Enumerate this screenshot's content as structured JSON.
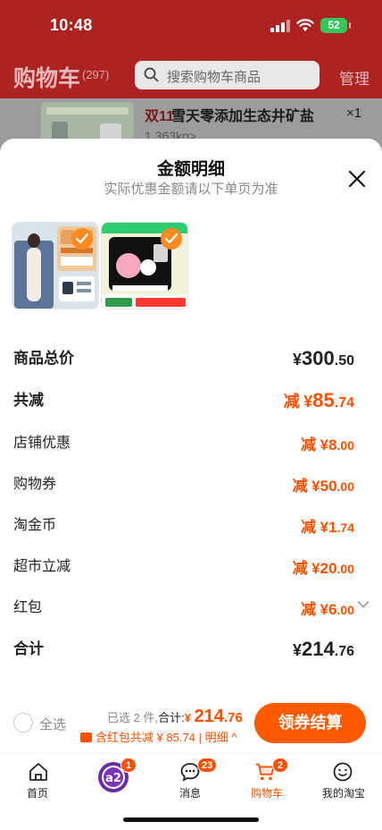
{
  "status": {
    "time": "10:48",
    "battery": "52"
  },
  "header": {
    "title": "购物车",
    "count": "(297)",
    "search_placeholder": "搜索购物车商品",
    "manage_label": "管理"
  },
  "behind_item": {
    "badge": "双11",
    "name": "雪天零添加生态井矿盐",
    "qty": "×1",
    "spec": "1.363kg>"
  },
  "sheet": {
    "title": "金额明细",
    "subtitle": "实际优惠金额请以下单页为准",
    "rows": {
      "total": {
        "label": "商品总价",
        "prefix": "",
        "cur": "¥",
        "int": "300",
        "dec": ".50"
      },
      "reduce": {
        "label": "共减",
        "prefix": "减",
        "cur": "¥",
        "int": "85",
        "dec": ".74"
      },
      "store": {
        "label": "店铺优惠",
        "prefix": "减",
        "cur": "¥",
        "int": "8",
        "dec": ".00"
      },
      "voucher": {
        "label": "购物券",
        "prefix": "减",
        "cur": "¥",
        "int": "50",
        "dec": ".00"
      },
      "coins": {
        "label": "淘金币",
        "prefix": "减",
        "cur": "¥",
        "int": "1",
        "dec": ".74"
      },
      "market": {
        "label": "超市立减",
        "prefix": "减",
        "cur": "¥",
        "int": "20",
        "dec": ".00"
      },
      "redpacket": {
        "label": "红包",
        "prefix": "减",
        "cur": "¥",
        "int": "6",
        "dec": ".00"
      },
      "sum": {
        "label": "合计",
        "prefix": "",
        "cur": "¥",
        "int": "214",
        "dec": ".76"
      }
    }
  },
  "checkout": {
    "select_all": "全选",
    "selected": "已选 2 件,",
    "sum_label": "合计:",
    "cur": "¥",
    "int": "214",
    "dec": ".76",
    "coupon_line": "含红包共减 ¥ 85.74 | 明细 ^",
    "button": "领券结算"
  },
  "tabs": [
    {
      "label": "首页",
      "badge": ""
    },
    {
      "label": "",
      "badge": "1"
    },
    {
      "label": "消息",
      "badge": "23"
    },
    {
      "label": "购物车",
      "badge": "2"
    },
    {
      "label": "我的淘宝",
      "badge": ""
    }
  ],
  "colors": {
    "header_red": "#ad2322",
    "accent_orange": "#ff5000"
  },
  "icons": [
    "signal-icon",
    "wifi-icon",
    "search-icon",
    "close-icon",
    "check-icon",
    "chevron-down-icon",
    "home-icon",
    "a2-logo-icon",
    "message-icon",
    "cart-icon",
    "profile-icon"
  ]
}
